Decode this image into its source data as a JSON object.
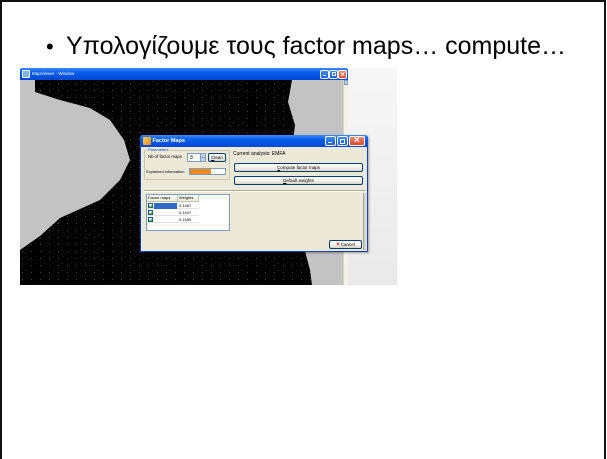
{
  "slide": {
    "bullet": "•",
    "text": "Υπολογίζουμε τους factor maps… compute…"
  },
  "app_window": {
    "title": "MapViewer - Window",
    "icon": "app-icon",
    "controls": [
      "minimize-icon",
      "maximize-icon",
      "close-icon"
    ]
  },
  "dialog": {
    "title": "Factor Maps",
    "icon": "factor-maps-icon",
    "parameters": {
      "group_label": "Parameters",
      "nb_label": "Nb of factor maps",
      "nb_value": "3",
      "clean_label": "Clean",
      "explained_label": "Explained information",
      "explained_fraction": 0.6
    },
    "current_analysis": "Current analysis: EMFA",
    "compute_label": "Compute factor maps",
    "default_weights_label": "Default weights",
    "table": {
      "headers": [
        "Factor maps",
        "Weights"
      ],
      "selected_row": 0,
      "rows": [
        {
          "checked": true,
          "weight": "0.1467"
        },
        {
          "checked": true,
          "weight": "0.1447"
        },
        {
          "checked": true,
          "weight": "0.1559"
        }
      ]
    },
    "cancel_label": "Cancel",
    "cancel_icon": "cancel-x-icon"
  },
  "colors": {
    "titlebar": "#0a5ee8",
    "close_button": "#e0452b",
    "map_background": "#c3c3c3",
    "map_shape": "#000000",
    "dialog_background": "#ece9d8",
    "explained_fill": "#f08a24",
    "selection": "#316ac5"
  }
}
